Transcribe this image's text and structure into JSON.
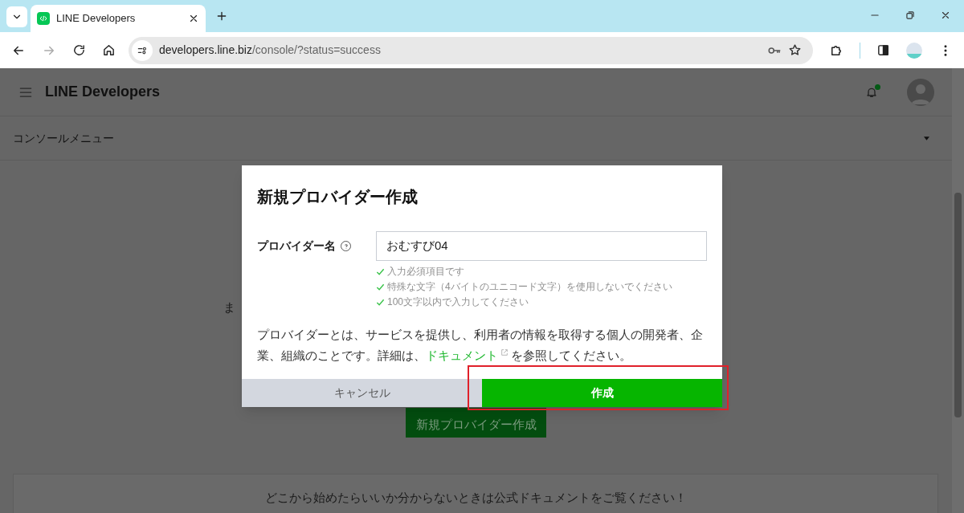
{
  "browser": {
    "tab": {
      "title": "LINE Developers"
    },
    "url": {
      "host": "developers.line.biz",
      "path": "/console/?status=success"
    }
  },
  "header": {
    "title": "LINE Developers",
    "notification": true
  },
  "console_menu": {
    "label": "コンソールメニュー"
  },
  "background": {
    "partial_text": "ま",
    "button": "新規プロバイダー作成",
    "notice": "どこから始めたらいいか分からないときは公式ドキュメントをご覧ください！"
  },
  "dialog": {
    "title": "新規プロバイダー作成",
    "field": {
      "label": "プロバイダー名",
      "value": "おむすび04"
    },
    "validations": [
      {
        "text": "入力必須項目です",
        "passed": true
      },
      {
        "text": "特殊な文字（4バイトのユニコード文字）を使用しないでください",
        "passed": true
      },
      {
        "text": "100文字以内で入力してください",
        "passed": true
      }
    ],
    "description": {
      "before": "プロバイダーとは、サービスを提供し、利用者の情報を取得する個人の開発者、企業、組織のことです。詳細は、",
      "link": "ドキュメント",
      "after": "を参照してください。"
    },
    "buttons": [
      {
        "label": "キャンセル",
        "kind": "secondary",
        "highlighted": false
      },
      {
        "label": "作成",
        "kind": "primary",
        "highlighted": true
      }
    ]
  }
}
